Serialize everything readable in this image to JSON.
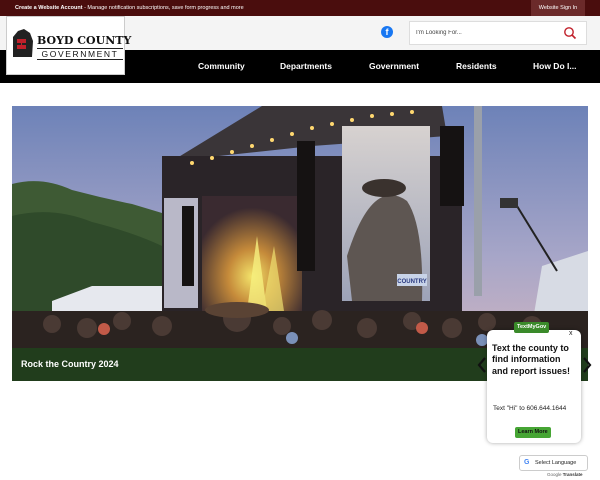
{
  "topbar": {
    "create_account": "Create a Website Account",
    "message": " - Manage notification subscriptions, save form progress and more",
    "sign_in": "Website Sign In"
  },
  "logo": {
    "line1": "BOYD COUNTY",
    "line2": "GOVERNMENT"
  },
  "search": {
    "placeholder": "I'm Looking For..."
  },
  "nav": {
    "items": [
      "Community",
      "Departments",
      "Government",
      "Residents",
      "How Do I..."
    ]
  },
  "hero": {
    "caption": "Rock the Country 2024",
    "screen_text": "COUNTRY"
  },
  "textmygov": {
    "badge": "TextMyGov",
    "close": "x",
    "heading": "Text the county to find information and report issues!",
    "body": "Text \"Hi\" to 606.644.1644",
    "button": "Learn More"
  },
  "translate": {
    "label": "Select Language",
    "powered_prefix": "Google",
    "powered_word": "Translate"
  },
  "colors": {
    "topbar": "#4a0d0d",
    "nav": "#000000",
    "caption": "#213d1c",
    "accent_green": "#46a534",
    "logo_red": "#c0202a"
  },
  "icons": [
    "facebook-icon",
    "search-icon",
    "chevron-left-icon",
    "chevron-right-icon",
    "google-icon"
  ]
}
